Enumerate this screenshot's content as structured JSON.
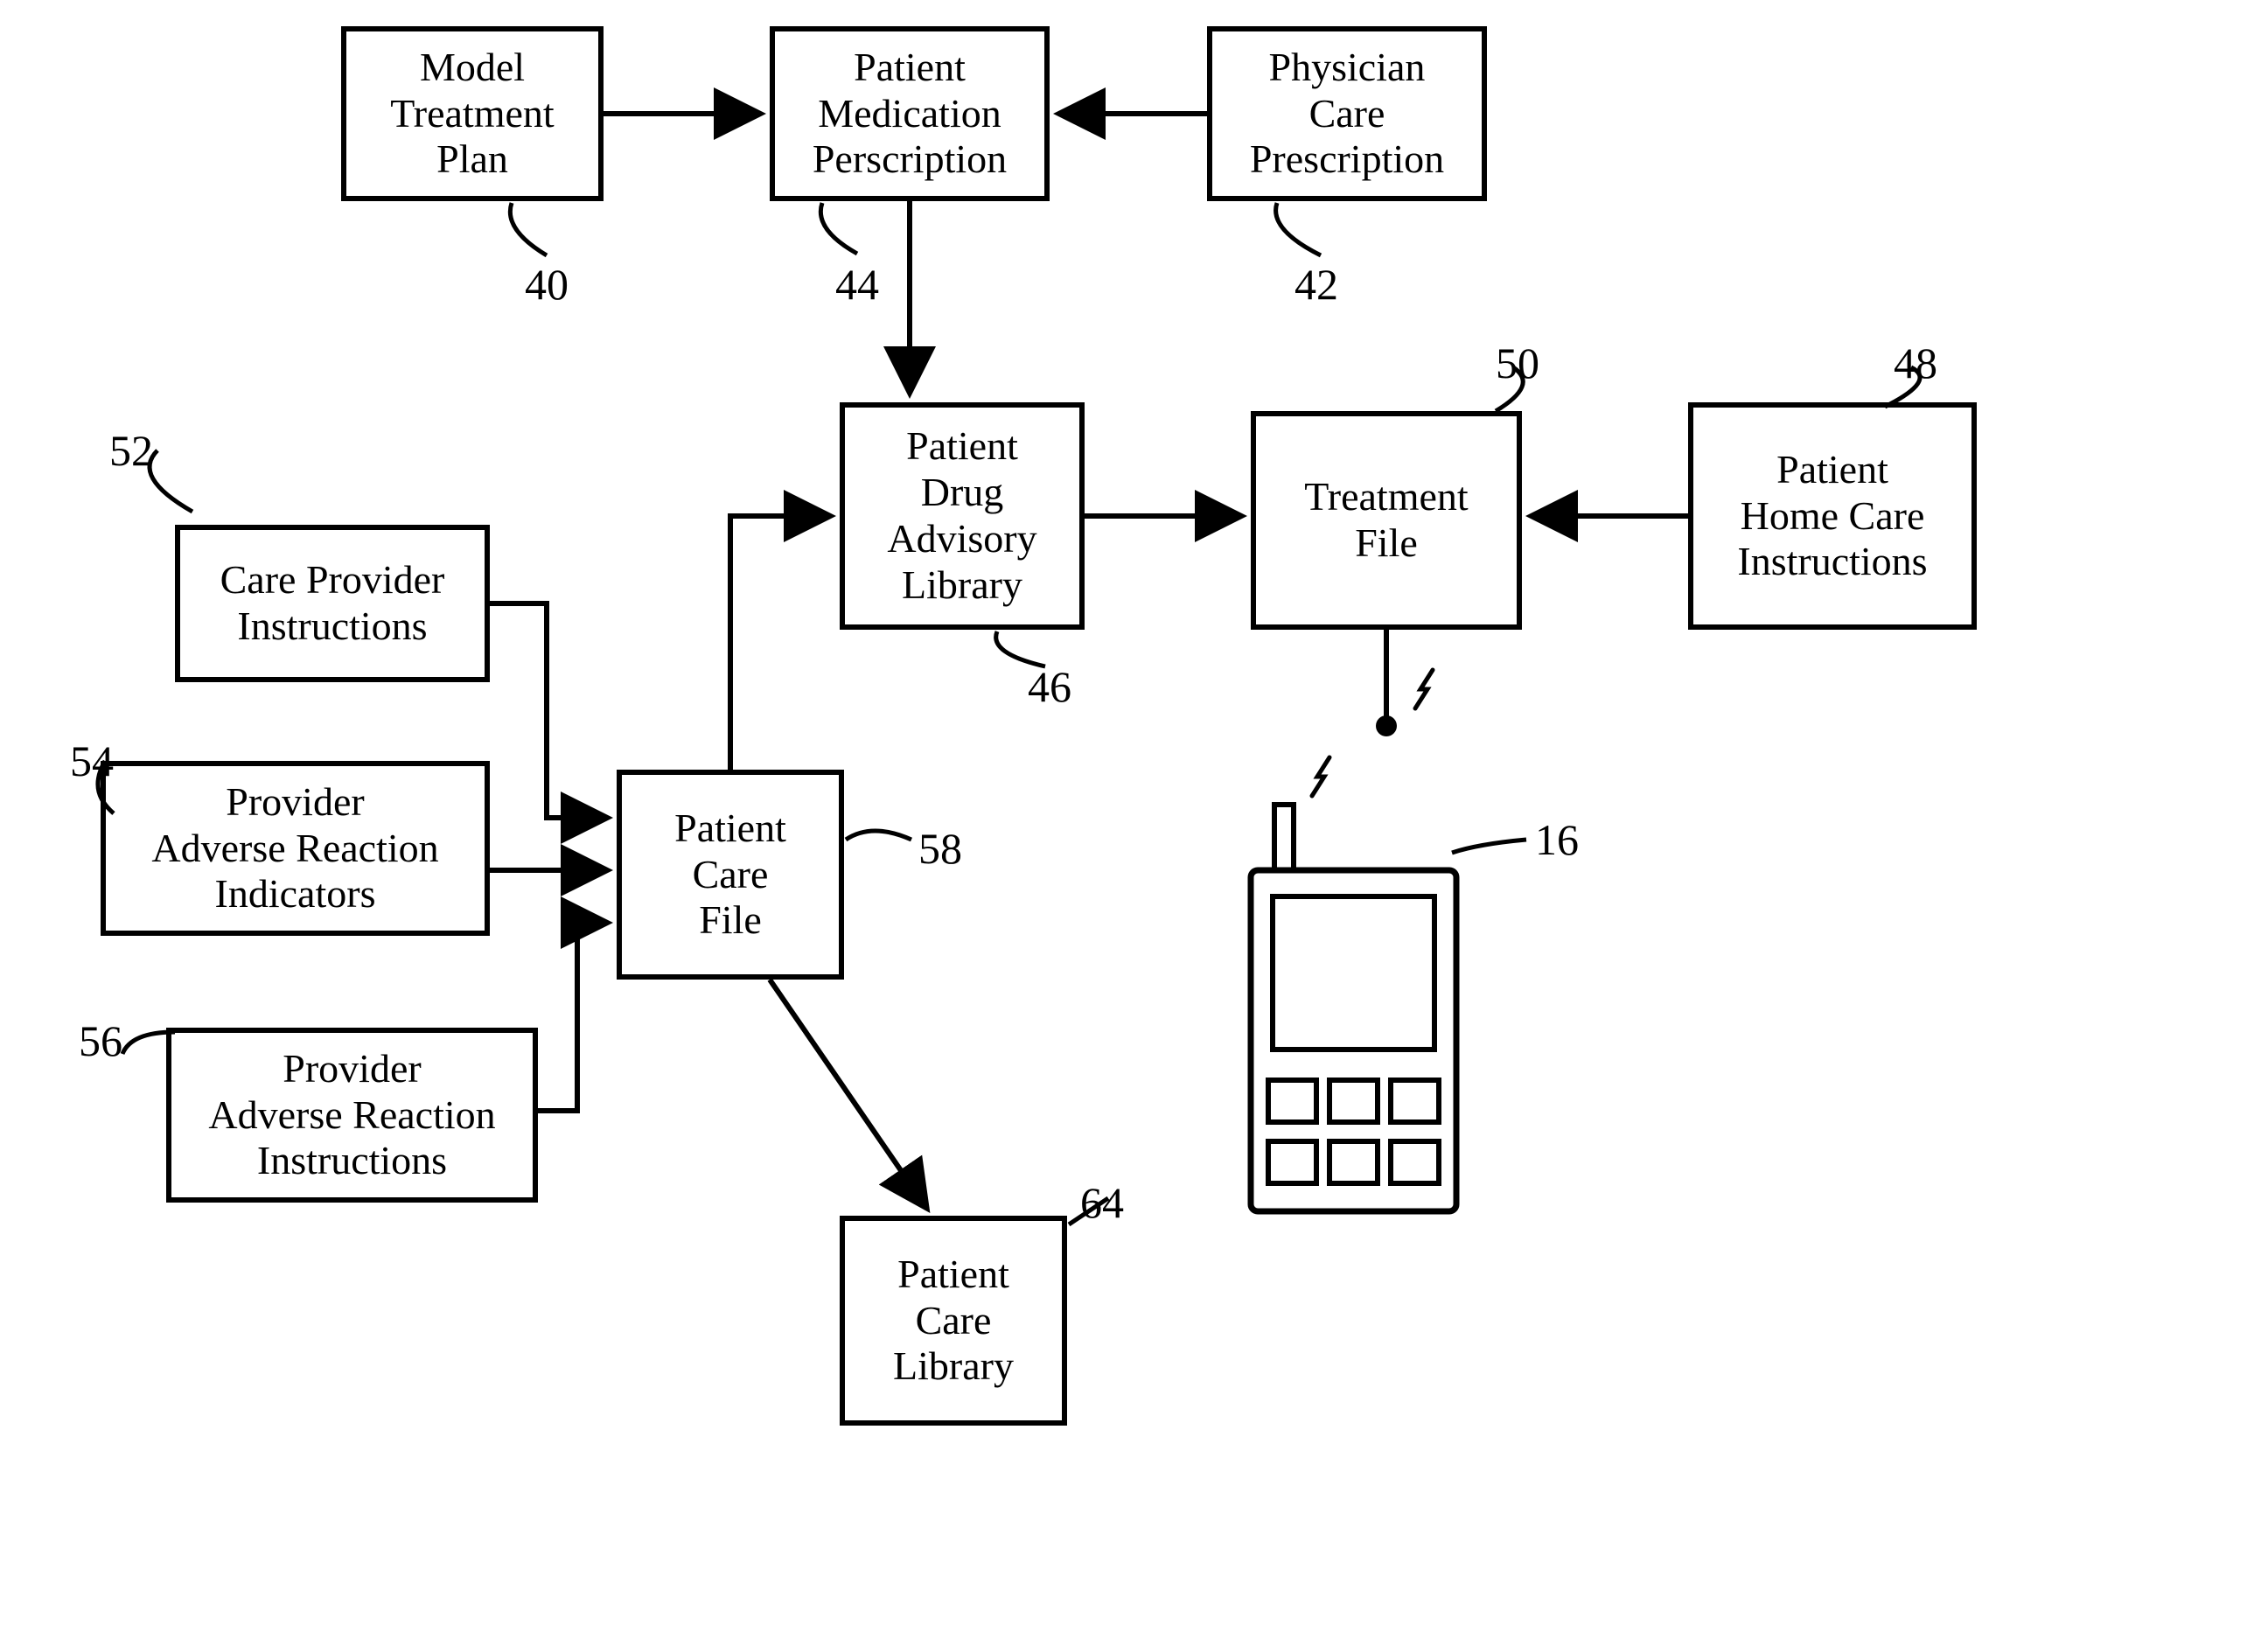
{
  "chart_data": {
    "type": "flowchart",
    "nodes": [
      {
        "id": "40",
        "label": "Model Treatment Plan"
      },
      {
        "id": "44",
        "label": "Patient Medication Perscription"
      },
      {
        "id": "42",
        "label": "Physician Care Prescription"
      },
      {
        "id": "46",
        "label": "Patient Drug Advisory Library"
      },
      {
        "id": "50",
        "label": "Treatment File"
      },
      {
        "id": "48",
        "label": "Patient Home Care Instructions"
      },
      {
        "id": "52",
        "label": "Care Provider Instructions"
      },
      {
        "id": "54",
        "label": "Provider Adverse Reaction Indicators"
      },
      {
        "id": "56",
        "label": "Provider Adverse Reaction Instructions"
      },
      {
        "id": "58",
        "label": "Patient Care File"
      },
      {
        "id": "64",
        "label": "Patient Care Library"
      },
      {
        "id": "16",
        "label": "handheld-device",
        "kind": "device"
      }
    ],
    "edges": [
      {
        "from": "40",
        "to": "44"
      },
      {
        "from": "42",
        "to": "44"
      },
      {
        "from": "44",
        "to": "46"
      },
      {
        "from": "46",
        "to": "50"
      },
      {
        "from": "48",
        "to": "50"
      },
      {
        "from": "50",
        "to": "16",
        "kind": "wireless"
      },
      {
        "from": "52",
        "to": "58"
      },
      {
        "from": "54",
        "to": "58"
      },
      {
        "from": "56",
        "to": "58"
      },
      {
        "from": "58",
        "to": "64"
      },
      {
        "from": "58",
        "to": "46"
      }
    ]
  },
  "boxes": {
    "b40": "Model\nTreatment\nPlan",
    "b44": "Patient\nMedication\nPerscription",
    "b42": "Physician\nCare\nPrescription",
    "b46": "Patient\nDrug\nAdvisory\nLibrary",
    "b50": "Treatment\nFile",
    "b48": "Patient\nHome Care\nInstructions",
    "b52": "Care Provider\nInstructions",
    "b54": "Provider\nAdverse Reaction\nIndicators",
    "b56": "Provider\nAdverse Reaction\nInstructions",
    "b58": "Patient\nCare\nFile",
    "b64": "Patient\nCare\nLibrary"
  },
  "refs": {
    "r40": "40",
    "r44": "44",
    "r42": "42",
    "r46": "46",
    "r50": "50",
    "r48": "48",
    "r52": "52",
    "r54": "54",
    "r56": "56",
    "r58": "58",
    "r64": "64",
    "r16": "16"
  }
}
